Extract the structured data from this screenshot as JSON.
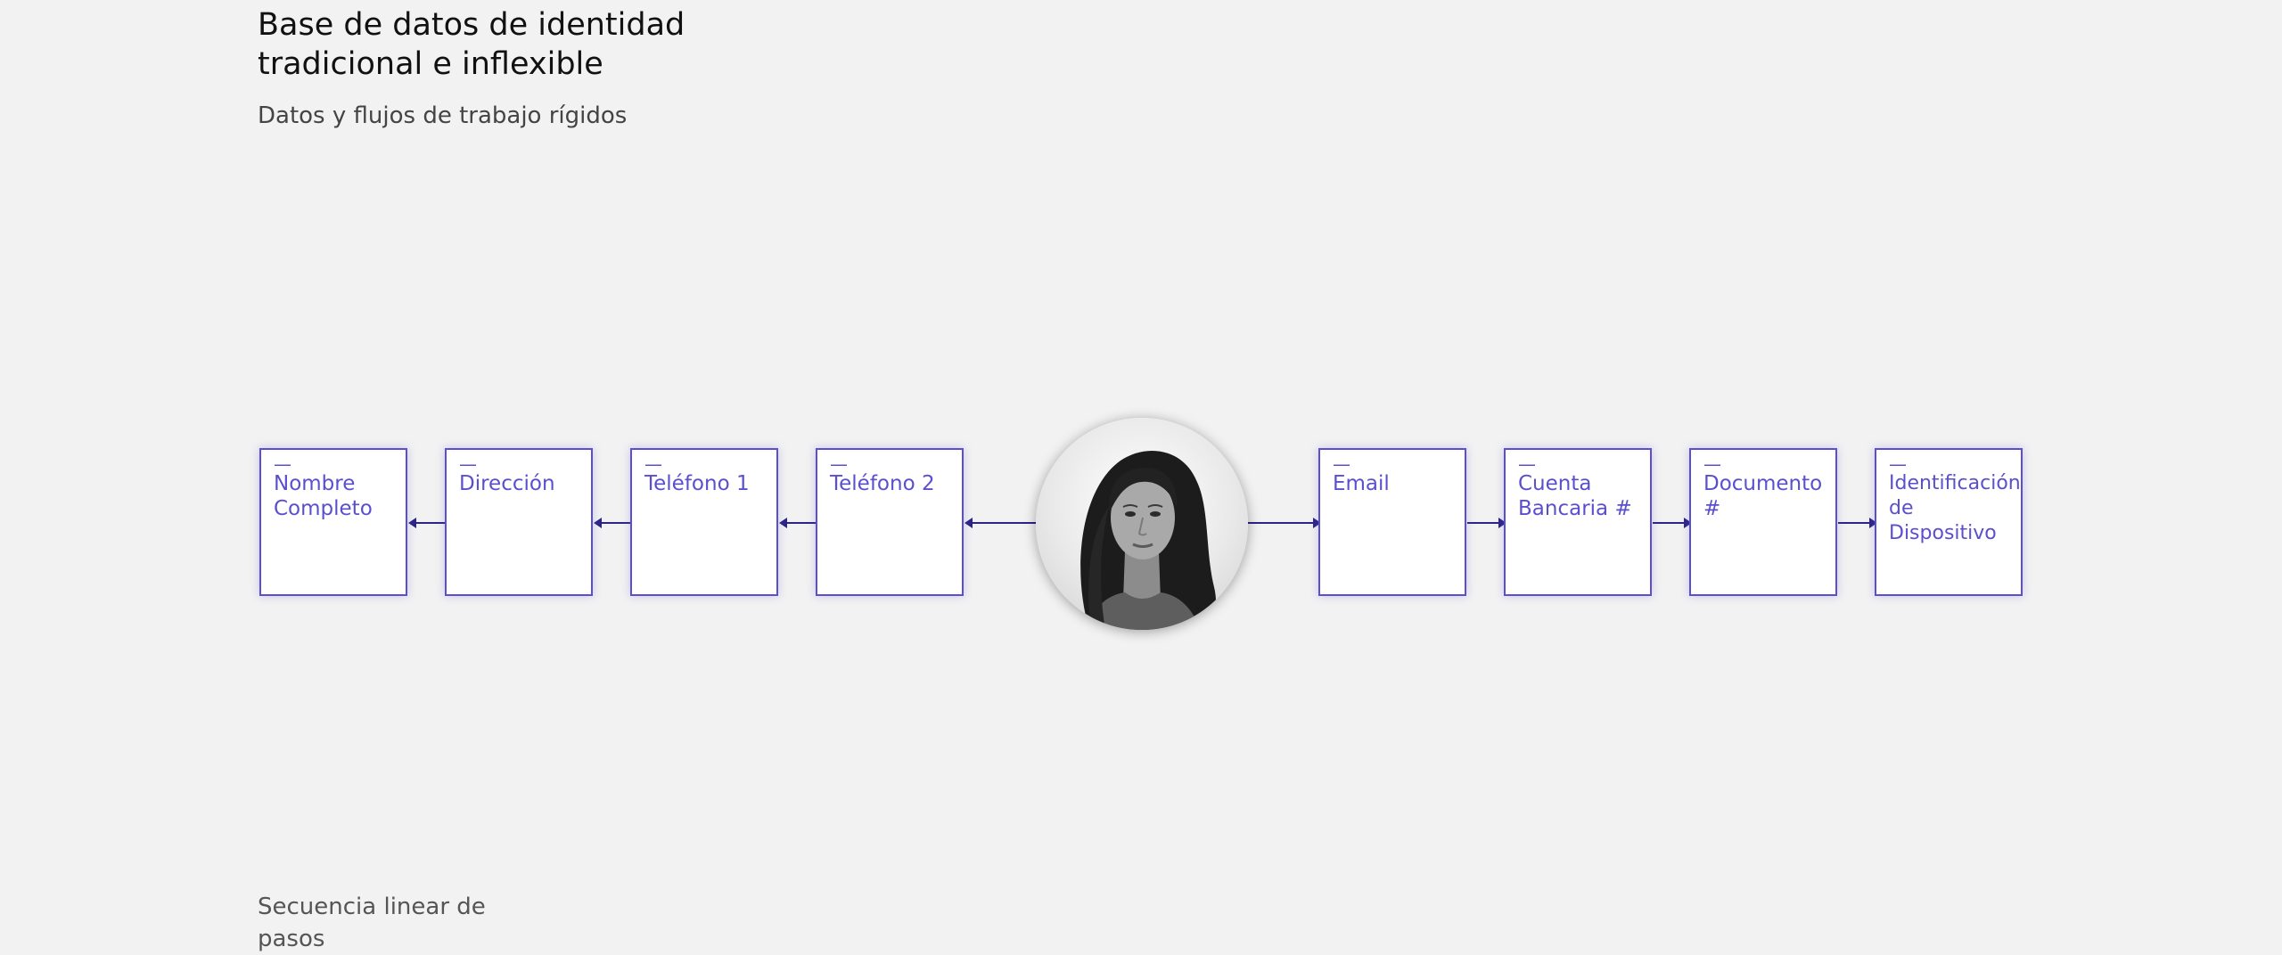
{
  "header": {
    "title": "Base de datos de identidad tradicional e inflexible",
    "subtitle": "Datos y flujos de trabajo rígidos"
  },
  "center": {
    "avatar_icon": "person-portrait"
  },
  "nodes_left": [
    {
      "dash": "—",
      "label": "Nombre Completo"
    },
    {
      "dash": "—",
      "label": "Dirección"
    },
    {
      "dash": "—",
      "label": "Teléfono 1"
    },
    {
      "dash": "—",
      "label": "Teléfono 2"
    }
  ],
  "nodes_right": [
    {
      "dash": "—",
      "label": "Email"
    },
    {
      "dash": "—",
      "label": "Cuenta Bancaria #"
    },
    {
      "dash": "—",
      "label": "Documento #"
    },
    {
      "dash": "—",
      "label": "Identificación de Dispositivo"
    }
  ],
  "footer": {
    "note": "Secuencia linear de pasos"
  },
  "colors": {
    "accent": "#5a4fcf",
    "connector": "#2c2486",
    "background": "#f2f2f2"
  }
}
